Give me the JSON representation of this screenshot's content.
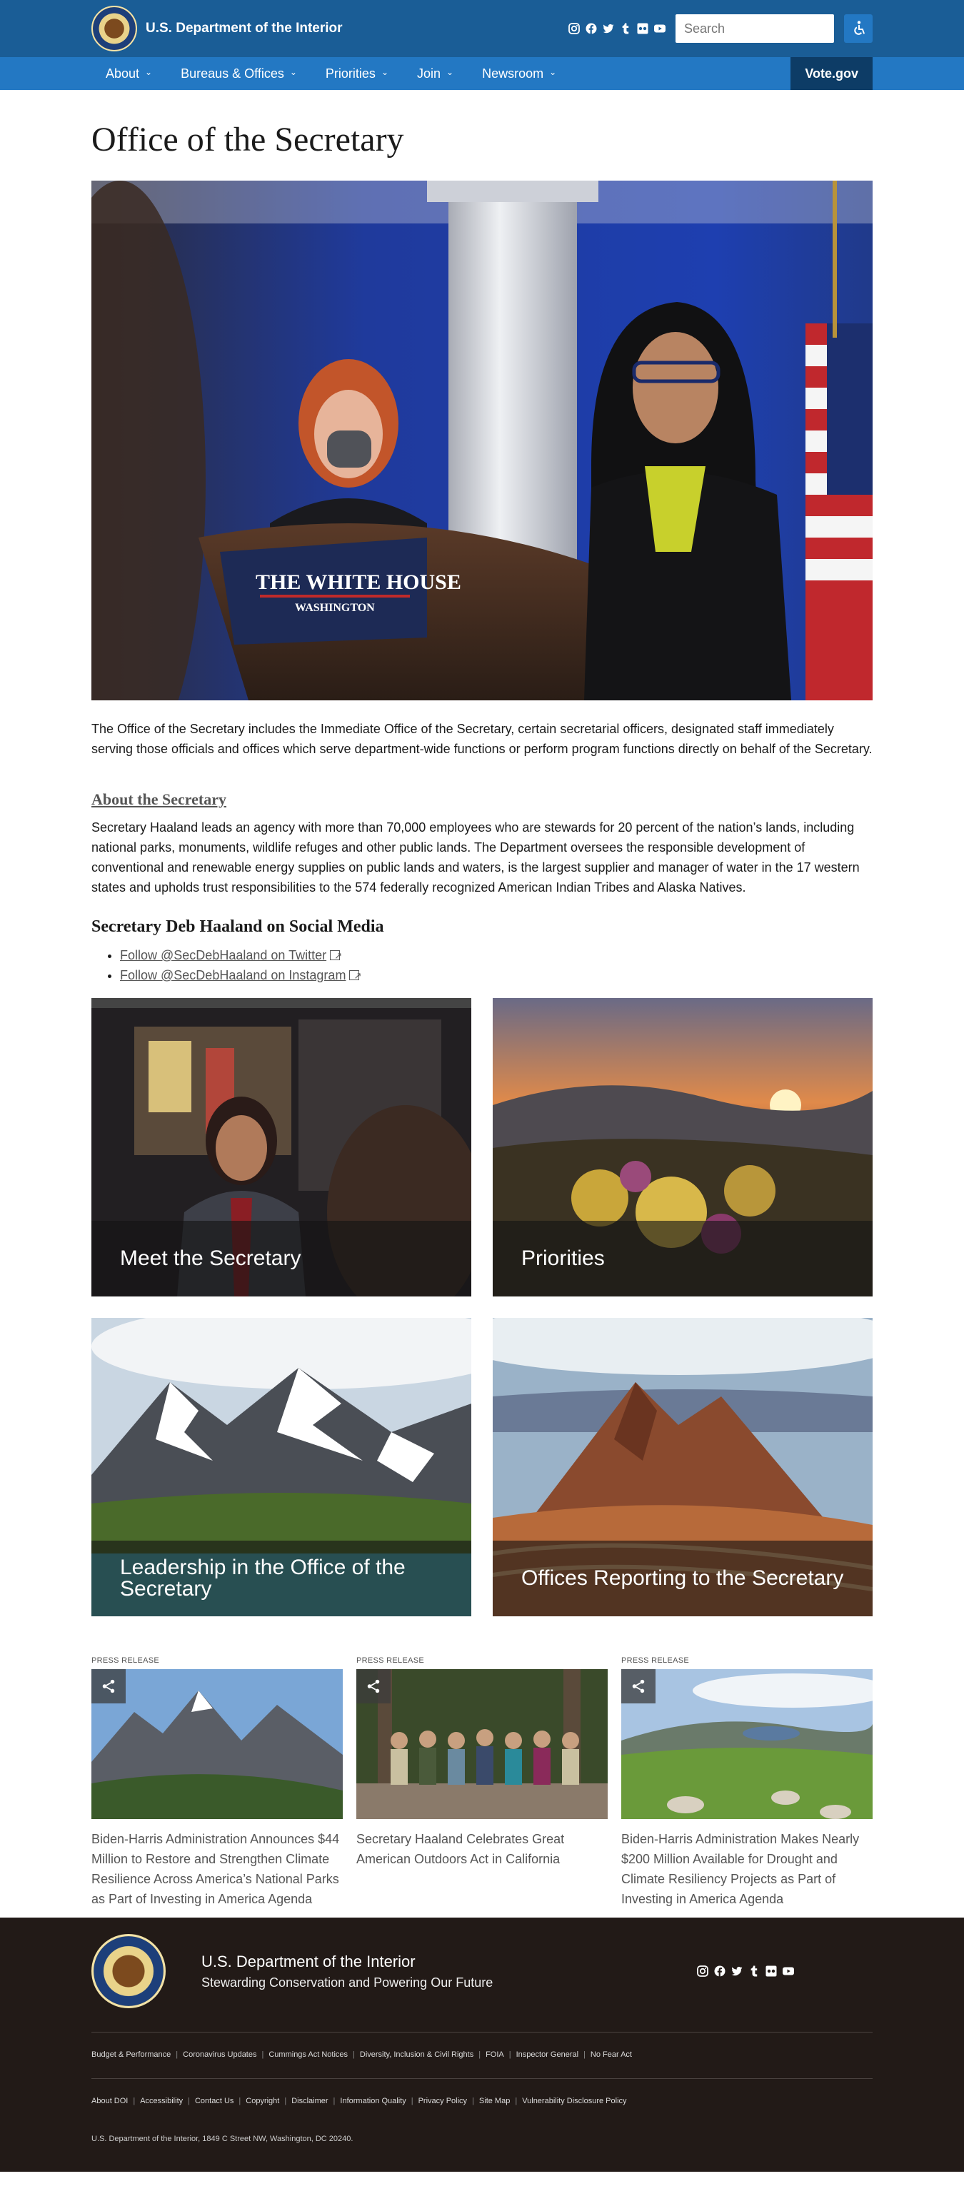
{
  "header": {
    "agency_name": "U.S. Department of the Interior",
    "social_icons": [
      "instagram-icon",
      "facebook-icon",
      "twitter-icon",
      "tumblr-icon",
      "flickr-icon",
      "youtube-icon"
    ],
    "search": {
      "placeholder": "Search"
    },
    "colors": {
      "topbar": "#1a5d96",
      "navbar": "#2378c3",
      "vote": "#0d3c66"
    }
  },
  "nav": {
    "items": [
      {
        "label": "About"
      },
      {
        "label": "Bureaus & Offices"
      },
      {
        "label": "Priorities"
      },
      {
        "label": "Join"
      },
      {
        "label": "Newsroom"
      }
    ],
    "vote_label": "Vote.gov"
  },
  "main": {
    "title": "Office of the Secretary",
    "hero_podium_text_1": "THE WHITE HOUSE",
    "hero_podium_text_2": "WASHINGTON",
    "intro": "The Office of the Secretary includes the Immediate Office of the Secretary, certain secretarial officers, designated staff immediately serving those officials and offices which serve department-wide functions or perform program functions directly on behalf of the Secretary.",
    "about_heading": "About the Secretary",
    "about_text": "Secretary Haaland leads an agency with more than 70,000 employees who are stewards for 20 percent of the nation’s lands, including national parks, monuments, wildlife refuges and other public lands. The Department oversees the responsible development of conventional and renewable energy supplies on public lands and waters, is the largest supplier and manager of water in the 17 western states and upholds trust responsibilities to the 574 federally recognized American Indian Tribes and Alaska Natives.",
    "social_heading": "Secretary Deb Haaland on Social Media",
    "social_links": [
      {
        "label": "Follow @SecDebHaaland on Twitter"
      },
      {
        "label": "Follow @SecDebHaaland on Instagram"
      }
    ],
    "cards": [
      {
        "label": "Meet the Secretary"
      },
      {
        "label": "Priorities"
      },
      {
        "label": "Leadership in the Office of the Secretary"
      },
      {
        "label": "Offices Reporting to the Secretary"
      }
    ],
    "press": [
      {
        "tag": "PRESS RELEASE",
        "title": "Biden-Harris Administration Announces $44 Million to Restore and Strengthen Climate Resilience Across America’s National Parks as Part of Investing in America Agenda"
      },
      {
        "tag": "PRESS RELEASE",
        "title": "Secretary Haaland Celebrates Great American Outdoors Act in California"
      },
      {
        "tag": "PRESS RELEASE",
        "title": "Biden-Harris Administration Makes Nearly $200 Million Available for Drought and Climate Resiliency Projects as Part of Investing in America Agenda"
      }
    ]
  },
  "footer": {
    "name": "U.S. Department of the Interior",
    "tagline": "Stewarding Conservation and Powering Our Future",
    "links_row_1": [
      "Budget & Performance",
      "Coronavirus Updates",
      "Cummings Act Notices",
      "Diversity, Inclusion & Civil Rights",
      "FOIA",
      "Inspector General",
      "No Fear Act"
    ],
    "links_row_2": [
      "About DOI",
      "Accessibility",
      "Contact Us",
      "Copyright",
      "Disclaimer",
      "Information Quality",
      "Privacy Policy",
      "Site Map",
      "Vulnerability Disclosure Policy"
    ],
    "address": "U.S. Department of the Interior, 1849 C Street NW, Washington, DC 20240.",
    "colors": {
      "background": "#221a17"
    }
  }
}
